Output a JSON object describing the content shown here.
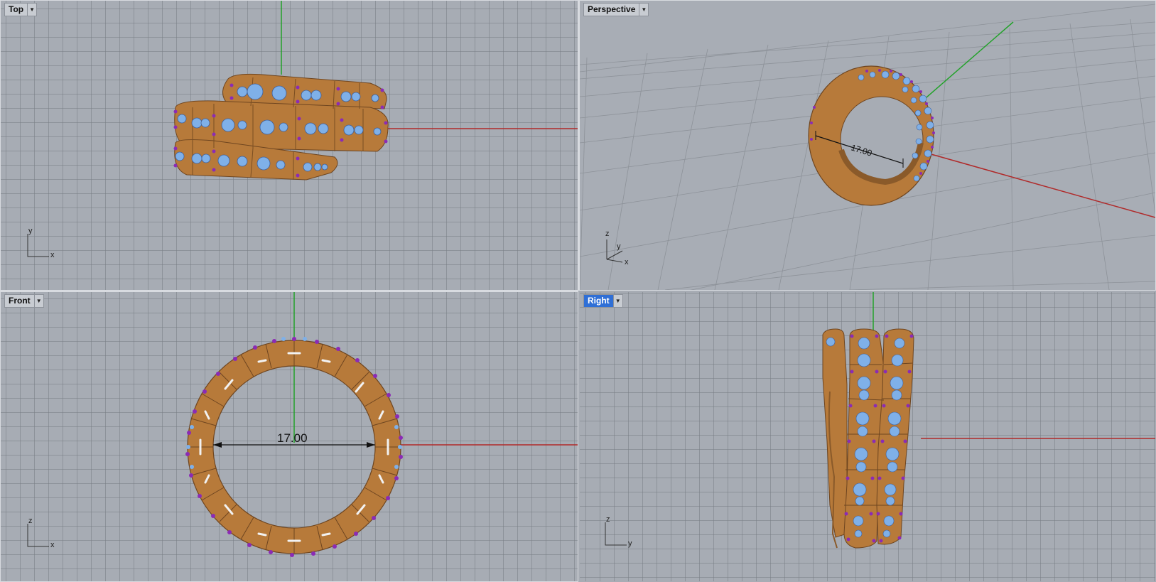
{
  "viewports": {
    "top": {
      "label": "Top",
      "axis_labels": [
        "y",
        "x"
      ]
    },
    "perspective": {
      "label": "Perspective",
      "axis_labels": [
        "z",
        "y",
        "x"
      ]
    },
    "front": {
      "label": "Front",
      "axis_labels": [
        "z",
        "x"
      ]
    },
    "right": {
      "label": "Right",
      "axis_labels": [
        "z",
        "y"
      ]
    }
  },
  "dimensions": {
    "perspective_value": "17.00",
    "front_value": "17.00"
  },
  "active_viewport": "Right",
  "colors": {
    "viewport_bg": "#a7acb4",
    "grid_line": "#7d8289",
    "x_axis": "#b02a2a",
    "y_axis": "#22a22a",
    "metal": "#b77a3a",
    "gem": "#7fb0e8",
    "prong": "#8b2bb5",
    "active_tab": "#2f6fd6"
  },
  "icons": {
    "dropdown": "chevron-down-icon"
  }
}
